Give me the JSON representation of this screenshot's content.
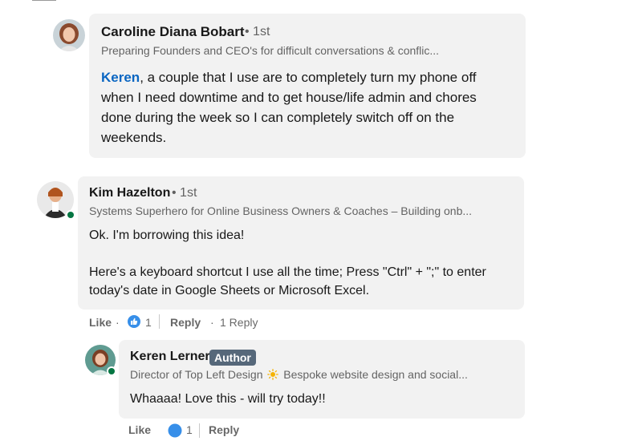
{
  "comments": [
    {
      "author": "Caroline Diana Bobart",
      "degree": "• 1st",
      "headline": "Preparing Founders and CEO's for difficult conversations & conflic...",
      "mention": "Keren",
      "text_line1_rest": ", a couple that I use are to completely turn my phone off",
      "text_line2": "when I need downtime and to get house/life admin and chores",
      "text_line3": "done during the week so I can completely switch off on the",
      "text_line4": "weekends."
    },
    {
      "author": "Kim Hazelton",
      "degree": "• 1st",
      "headline": "Systems Superhero for Online Business Owners & Coaches – Building onb...",
      "paragraph1": "Ok. I'm borrowing this idea!",
      "paragraph2_line1": "Here's a keyboard shortcut I use all the time; Press \"Ctrl\" + \";\" to enter",
      "paragraph2_line2": "today's date in Google Sheets or Microsoft Excel.",
      "actions": {
        "like": "Like",
        "reaction_count": "1",
        "reply": "Reply",
        "replies": "1 Reply"
      }
    },
    {
      "author": "Keren Lerner",
      "badge": "Author",
      "headline_part1": "Director of Top Left Design",
      "headline_part2": "Bespoke website design and social...",
      "text": "Whaaaa! Love this - will try today!!",
      "actions": {
        "like": "Like",
        "reaction_count": "1",
        "reply": "Reply"
      }
    }
  ],
  "colors": {
    "bubble": "#f2f2f2",
    "link": "#0a66c2",
    "online": "#057642",
    "badge": "#56687a"
  },
  "icons": [
    "like-reaction-icon",
    "sun-emoji-icon",
    "online-status-icon"
  ]
}
